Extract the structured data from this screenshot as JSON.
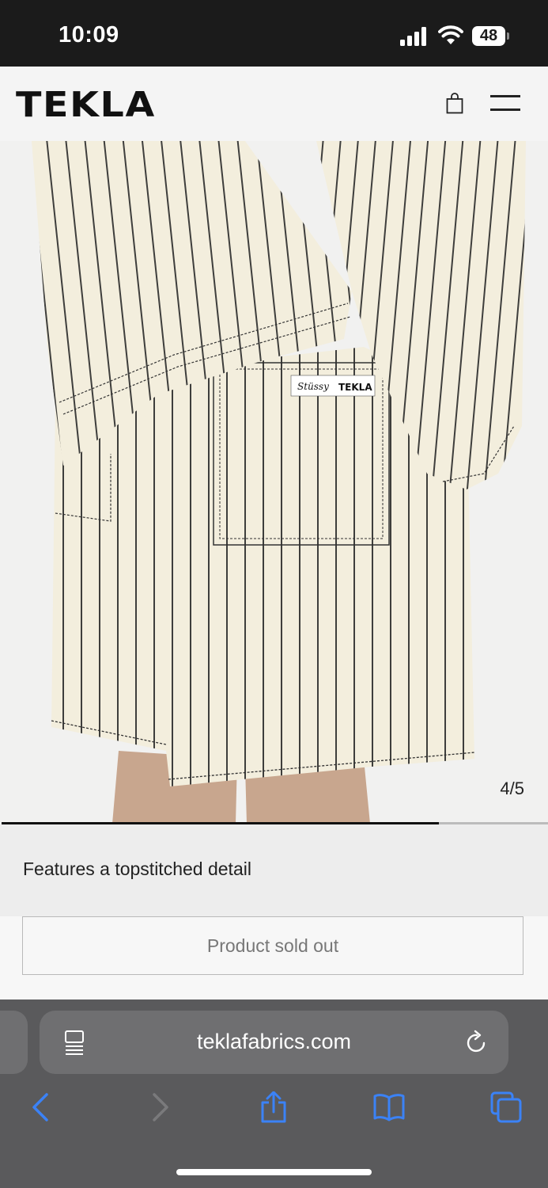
{
  "status_bar": {
    "time": "10:09",
    "battery": "48"
  },
  "site": {
    "logo": "TEKLA"
  },
  "product": {
    "image_counter": "4/5",
    "image_index": 4,
    "image_total": 5,
    "slider_progress": 0.8,
    "description": "Features a topstitched detail",
    "sold_out_label": "Product sold out",
    "label_brand_1": "Stüssy",
    "label_brand_2": "TEKLA"
  },
  "browser": {
    "url": "teklafabrics.com"
  },
  "colors": {
    "fabric": "#f3eedd",
    "stripe": "#2a2a2a",
    "accent_blue": "#3b82f6",
    "status_bar_bg": "#1b1b1b",
    "browser_bg": "#5a5a5c"
  },
  "icons": {
    "cart": "shopping-bag-icon",
    "menu": "hamburger-menu-icon",
    "reader": "reader-mode-icon",
    "reload": "reload-icon",
    "back": "chevron-left-icon",
    "forward": "chevron-right-icon",
    "share": "share-icon",
    "bookmarks": "book-icon",
    "tabs": "tabs-icon"
  }
}
